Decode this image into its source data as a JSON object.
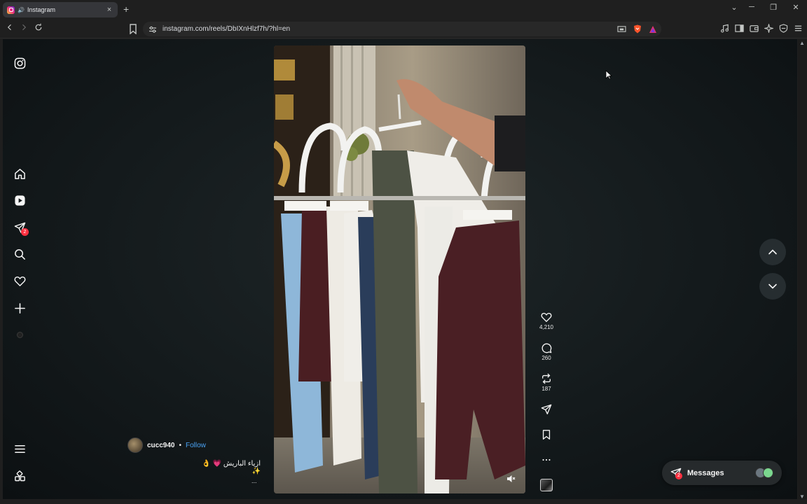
{
  "browser": {
    "tab_title": "Instagram",
    "tab_close": "×",
    "new_tab": "+",
    "url": "instagram.com/reels/DbIXnHlzf7h/?hl=en",
    "window_controls": {
      "tabs_menu": "⌄",
      "minimize": "─",
      "restore": "❐",
      "close": "✕"
    }
  },
  "reel": {
    "author": "cucc940",
    "separator": "•",
    "follow_label": "Follow",
    "caption": "ازياء الباريش 💗 👌 ✨",
    "more": "...",
    "likes": "4,210",
    "comments": "260",
    "reposts": "187"
  },
  "messages": {
    "label": "Messages",
    "badge": "2"
  },
  "nav": {
    "dm_badge": "2"
  },
  "colors": {
    "accent_link": "#4aa3f5",
    "badge": "#ff3040"
  }
}
